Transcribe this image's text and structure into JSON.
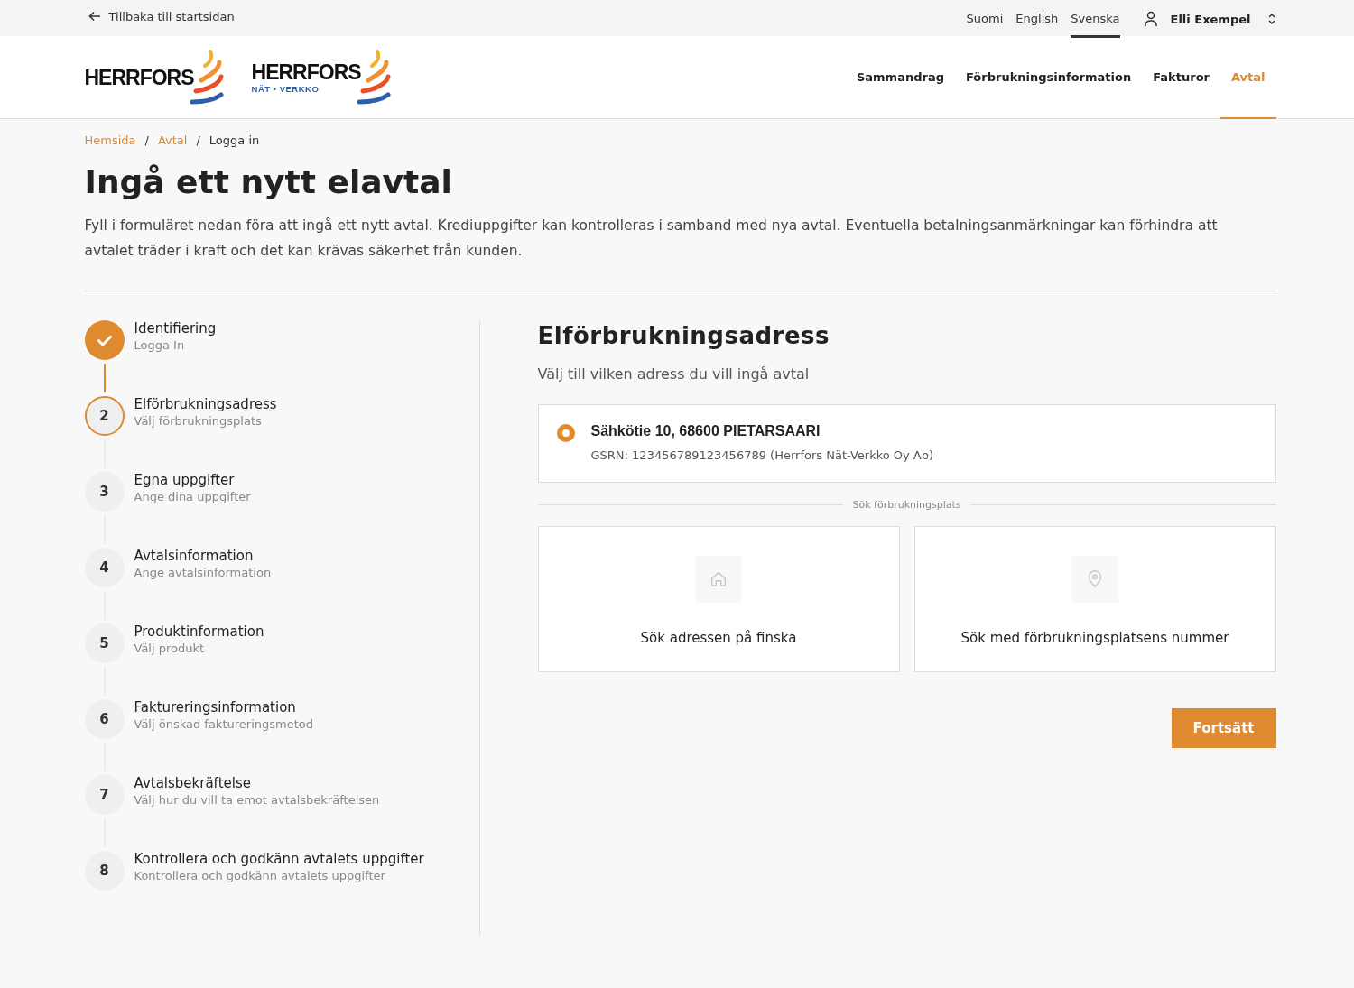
{
  "top_bar": {
    "back_link": "Tillbaka till startsidan",
    "languages": [
      {
        "label": "Suomi",
        "selected": false
      },
      {
        "label": "English",
        "selected": false
      },
      {
        "label": "Svenska",
        "selected": true
      }
    ],
    "user": "Elli Exempel"
  },
  "logos": [
    {
      "name": "HERRFORS"
    },
    {
      "name": "HERRFORS",
      "subtitle": "NÄT • VERKKO"
    }
  ],
  "nav": [
    {
      "label": "Sammandrag",
      "selected": false
    },
    {
      "label": "Förbrukningsinformation",
      "selected": false
    },
    {
      "label": "Fakturor",
      "selected": false
    },
    {
      "label": "Avtal",
      "selected": true
    }
  ],
  "breadcrumb": {
    "separator": "/",
    "items": [
      "Hemsida",
      "Avtal",
      "Logga in"
    ]
  },
  "title": "Ingå ett nytt elavtal",
  "intro": "Fyll i formuläret nedan föra att ingå ett nytt avtal. Krediuppgifter kan kontrolleras i samband med nya avtal. Eventuella betalningsanmärkningar kan förhindra att avtalet träder i kraft och det kan krävas säkerhet från kunden.",
  "steps": [
    {
      "title": "Identifiering",
      "subtitle": "Logga In",
      "completed": true,
      "current": false
    },
    {
      "number": "2",
      "title": "Elförbrukningsadress",
      "subtitle": "Välj förbrukningsplats",
      "completed": false,
      "current": true
    },
    {
      "number": "3",
      "title": "Egna uppgifter",
      "subtitle": "Ange dina uppgifter",
      "completed": false,
      "current": false
    },
    {
      "number": "4",
      "title": "Avtalsinformation",
      "subtitle": "Ange avtalsinformation",
      "completed": false,
      "current": false
    },
    {
      "number": "5",
      "title": "Produktinformation",
      "subtitle": "Välj produkt",
      "completed": false,
      "current": false
    },
    {
      "number": "6",
      "title": "Faktureringsinformation",
      "subtitle": "Välj önskad faktureringsmetod",
      "completed": false,
      "current": false
    },
    {
      "number": "7",
      "title": "Avtalsbekräftelse",
      "subtitle": "Välj hur du vill ta emot avtalsbekräftelsen",
      "completed": false,
      "current": false
    },
    {
      "number": "8",
      "title": "Kontrollera och godkänn avtalets uppgifter",
      "subtitle": "Kontrollera och godkänn avtalets uppgifter",
      "completed": false,
      "current": false
    }
  ],
  "panel": {
    "heading": "Elförbrukningsadress",
    "subheading": "Välj till vilken adress du vill ingå avtal",
    "addresses": [
      {
        "address": "Sähkötie 10, 68600 PIETARSAARI",
        "detail": "GSRN: 123456789123456789 (Herrfors Nät-Verkko Oy Ab)",
        "selected": true
      }
    ],
    "divider_label": "Sök förbrukningsplats",
    "search_options": [
      {
        "kind": "home",
        "label": "Sök adressen på finska"
      },
      {
        "kind": "pin",
        "label": "Sök med förbrukningsplatsens nummer"
      }
    ],
    "continue_button": "Fortsätt"
  }
}
